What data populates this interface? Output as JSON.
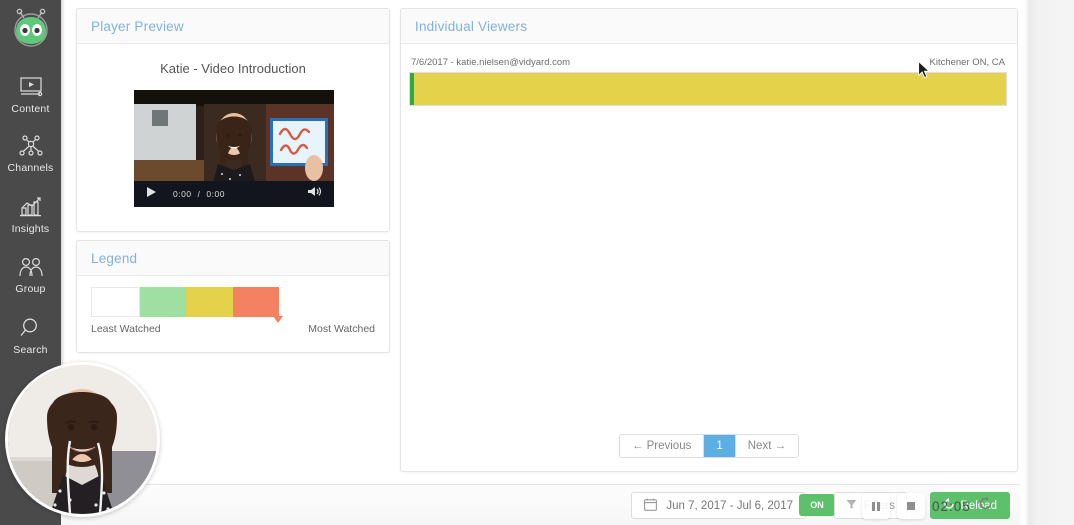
{
  "sidebar": {
    "logo_icon": "vidyard-alien-logo",
    "items": [
      {
        "label": "Content",
        "icon": "video-screen-icon"
      },
      {
        "label": "Channels",
        "icon": "network-nodes-icon"
      },
      {
        "label": "Insights",
        "icon": "bar-chart-icon"
      },
      {
        "label": "Group",
        "icon": "people-group-icon"
      },
      {
        "label": "Search",
        "icon": "magnifier-icon"
      }
    ]
  },
  "player_preview": {
    "title": "Player Preview",
    "video_title": "Katie - Video Introduction",
    "controls": {
      "play_icon": "play-icon",
      "current_time": "0:00",
      "separator": "/",
      "duration": "0:00",
      "volume_icon": "volume-icon"
    }
  },
  "legend": {
    "title": "Legend",
    "least_label": "Least Watched",
    "most_label": "Most Watched",
    "colors": [
      "#ffffff",
      "#9fdfa2",
      "#e4d24a",
      "#f58163"
    ]
  },
  "viewers": {
    "title": "Individual Viewers",
    "rows": [
      {
        "date": "7/6/2017",
        "email": "katie.nielsen@vidyard.com",
        "meta": "7/6/2017 - katie.nielsen@vidyard.com",
        "location": "Kitchener ON, CA",
        "segments": [
          {
            "color": "#2faa3f",
            "width_pct": 0.7
          },
          {
            "color": "#e4d24a",
            "width_pct": 99.3
          }
        ]
      }
    ],
    "pagination": {
      "previous": "← Previous",
      "current_page": "1",
      "next": "Next →"
    }
  },
  "footer": {
    "calendar_icon": "calendar-icon",
    "date_range": "Jun 7, 2017 - Jul 6, 2017",
    "toggle_label": "ON",
    "filters_label": "Filters",
    "filters_icon": "funnel-icon",
    "reload_label": "Reload",
    "reload_icon": "refresh-icon"
  },
  "recorder": {
    "pause_icon": "pause-icon",
    "stop_icon": "stop-icon",
    "elapsed": "02:05",
    "restart_icon": "restart-circle-icon"
  },
  "webcam": {
    "label": "webcam-bubble"
  },
  "cursor": {
    "label": "mouse-pointer"
  },
  "theme": {
    "accent_blue": "#7fb2e0",
    "page_blue": "#5bafe3",
    "green": "#5cc16a",
    "sidebar_bg": "#4a4a4a",
    "yellow": "#e4d24a"
  }
}
